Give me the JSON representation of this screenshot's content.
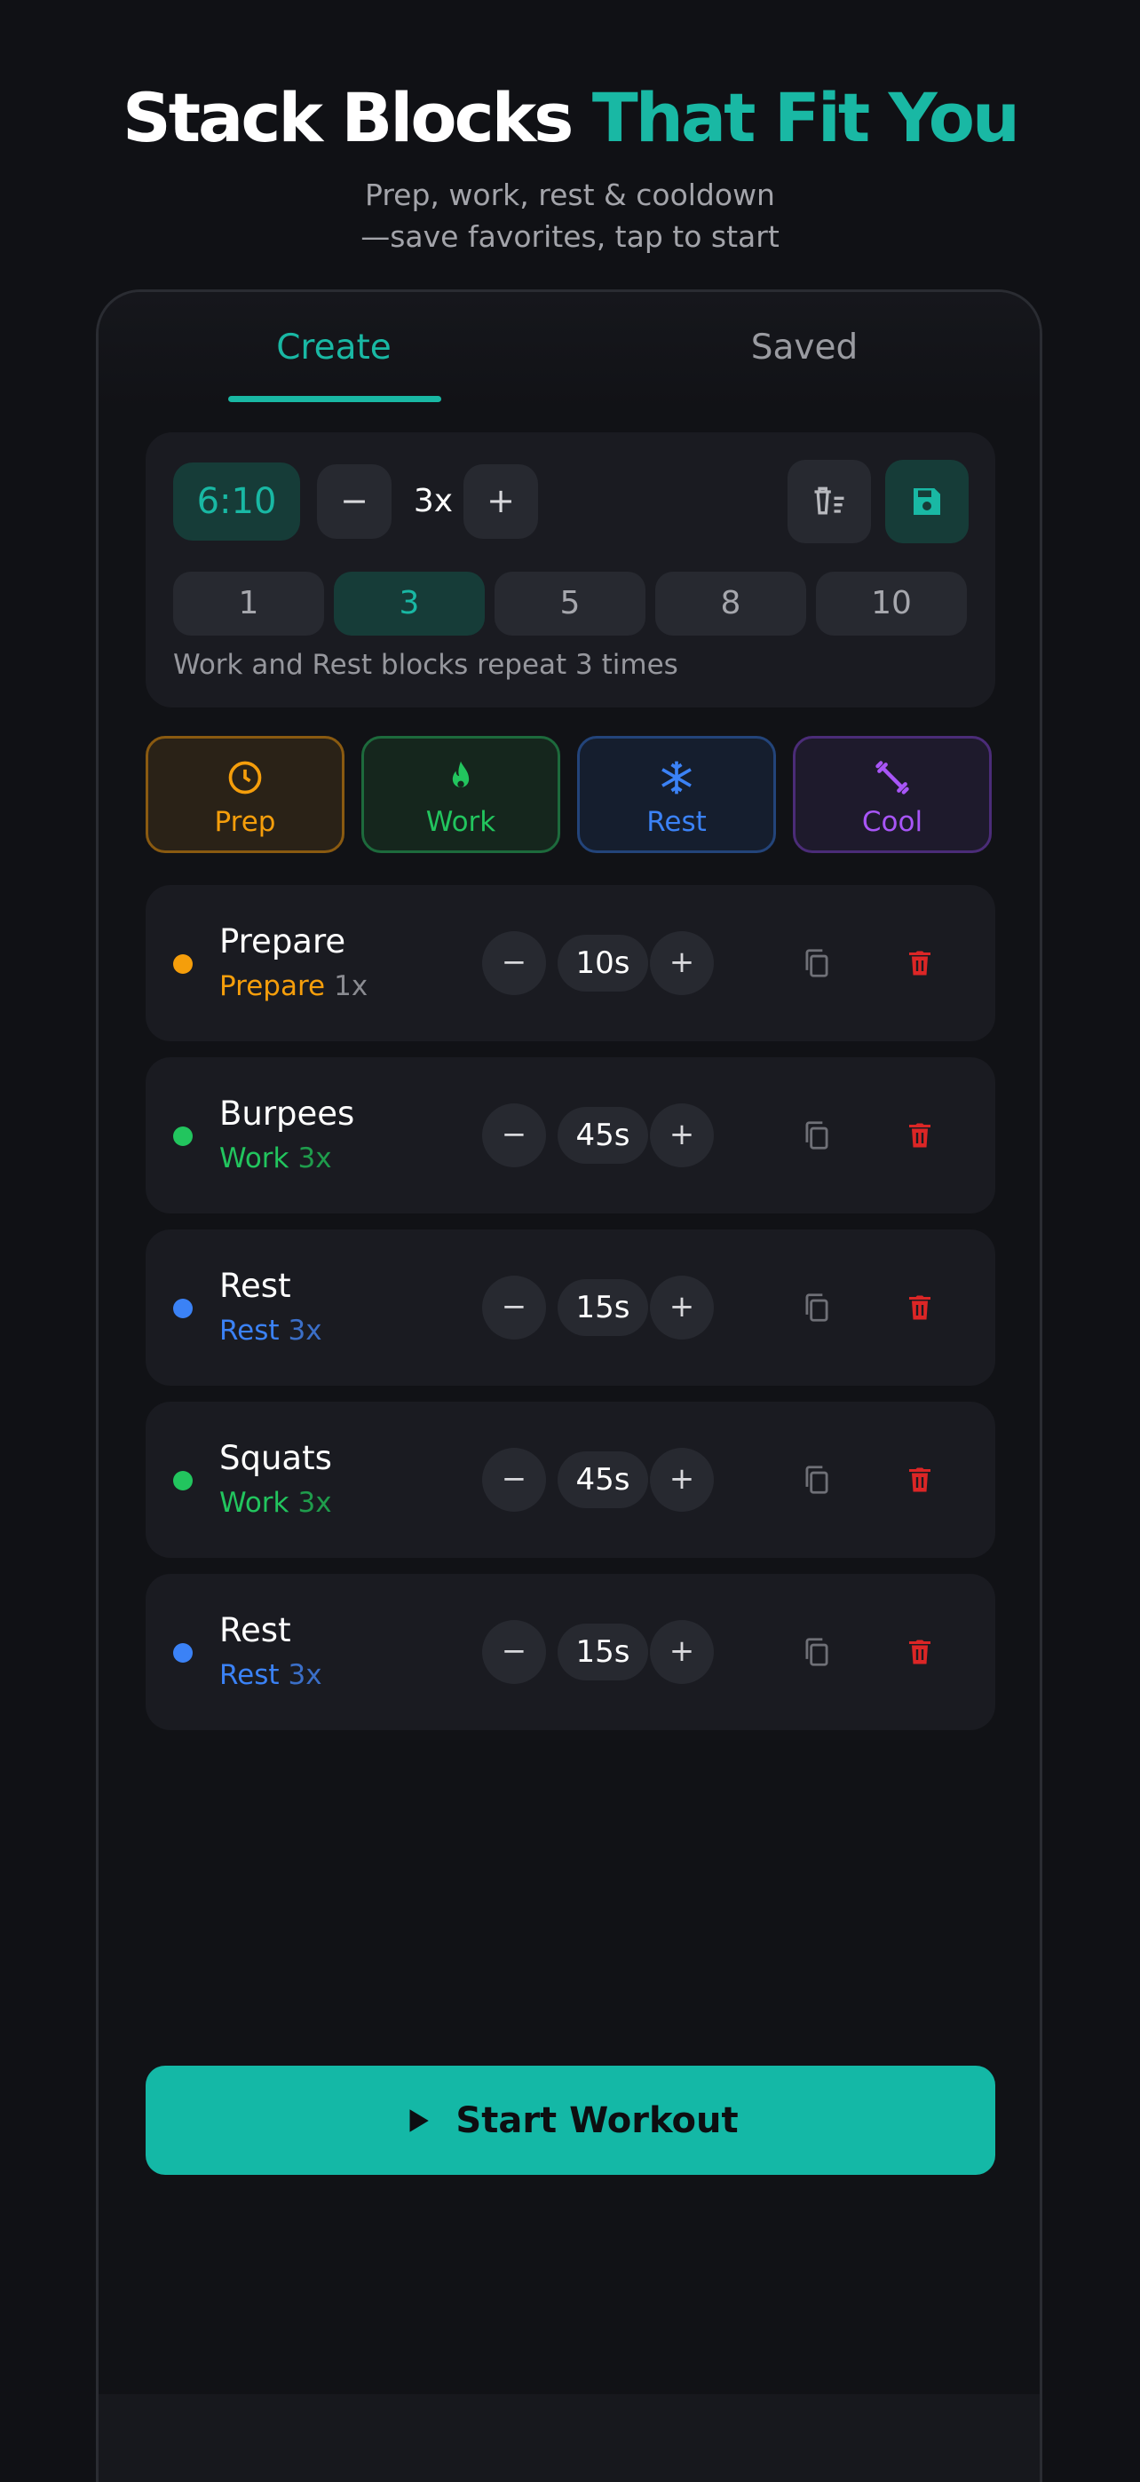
{
  "hero": {
    "title_main": "Stack Blocks",
    "title_accent": "That Fit You",
    "subtitle_line1": "Prep, work, rest & cooldown",
    "subtitle_line2": "—save favorites, tap to start",
    "accent_color": "#19b8a4"
  },
  "tabs": [
    {
      "label": "Create",
      "active": true
    },
    {
      "label": "Saved",
      "active": false
    }
  ],
  "summary": {
    "total_time": "6:10",
    "decrement_label": "−",
    "rounds_value": "3x",
    "increment_label": "+",
    "clear_icon": "clear-all-icon",
    "save_icon": "save-icon",
    "round_presets": [
      "1",
      "3",
      "5",
      "8",
      "10"
    ],
    "selected_preset": "3",
    "note": "Work and Rest blocks repeat 3 times"
  },
  "categories": [
    {
      "label": "Prep",
      "icon": "clock-icon",
      "color": "#f59e0b"
    },
    {
      "label": "Work",
      "icon": "flame-icon",
      "color": "#22c55e"
    },
    {
      "label": "Rest",
      "icon": "snowflake-icon",
      "color": "#3b82f6"
    },
    {
      "label": "Cool",
      "icon": "dumbbell-icon",
      "color": "#a855f7"
    }
  ],
  "blocks": [
    {
      "name": "Prepare",
      "type": "Prepare",
      "repeat": "1x",
      "duration": "10s",
      "color": "#f59e0b"
    },
    {
      "name": "Burpees",
      "type": "Work",
      "repeat": "3x",
      "duration": "45s",
      "color": "#22c55e"
    },
    {
      "name": "Rest",
      "type": "Rest",
      "repeat": "3x",
      "duration": "15s",
      "color": "#3b82f6"
    },
    {
      "name": "Squats",
      "type": "Work",
      "repeat": "3x",
      "duration": "45s",
      "color": "#22c55e"
    },
    {
      "name": "Rest",
      "type": "Rest",
      "repeat": "3x",
      "duration": "15s",
      "color": "#3b82f6"
    }
  ],
  "block_controls": {
    "minus": "−",
    "plus": "+",
    "duplicate_icon": "copy-icon",
    "delete_icon": "trash-icon",
    "delete_color": "#dc2626"
  },
  "start_button": {
    "label": "Start Workout",
    "icon": "play-icon"
  }
}
